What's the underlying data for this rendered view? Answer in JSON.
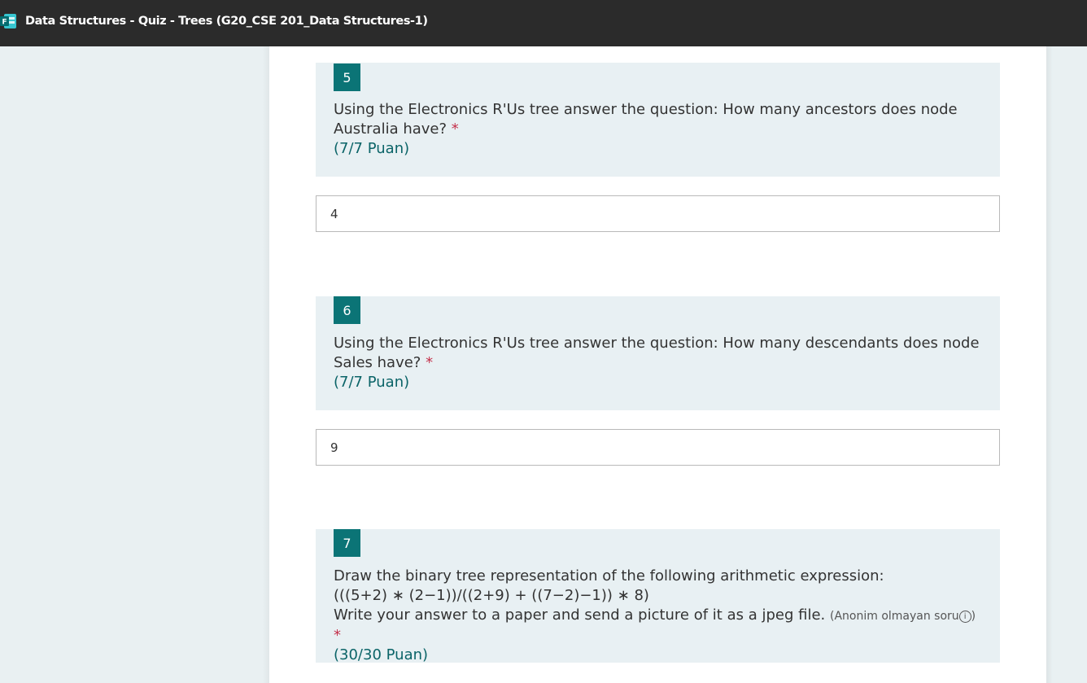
{
  "window": {
    "title": "Data Structures - Quiz - Trees (G20_CSE 201_Data Structures-1)",
    "icon": "forms-app-icon",
    "accent_color": "#0b7476"
  },
  "questions": [
    {
      "number": "5",
      "text": "Using the Electronics R'Us tree answer the question: How many ancestors does node Australia have?",
      "required_mark": "*",
      "points": "(7/7 Puan)",
      "answer": "4"
    },
    {
      "number": "6",
      "text": "Using the Electronics R'Us tree answer the question: How many descendants does node Sales have?",
      "required_mark": "*",
      "points": "(7/7 Puan)",
      "answer": "9"
    },
    {
      "number": "7",
      "line1": "Draw the binary tree representation of the following arithmetic expression:",
      "expression": "(((5+2) ∗ (2−1))/((2+9) + ((7−2)−1)) ∗ 8)",
      "line3": "Write your answer to a paper and send a picture of it as a jpeg file.",
      "note": "(Anonim olmayan soru",
      "note_close": ")",
      "info_symbol": "i",
      "required_mark": "*",
      "points": "(30/30 Puan)"
    }
  ]
}
